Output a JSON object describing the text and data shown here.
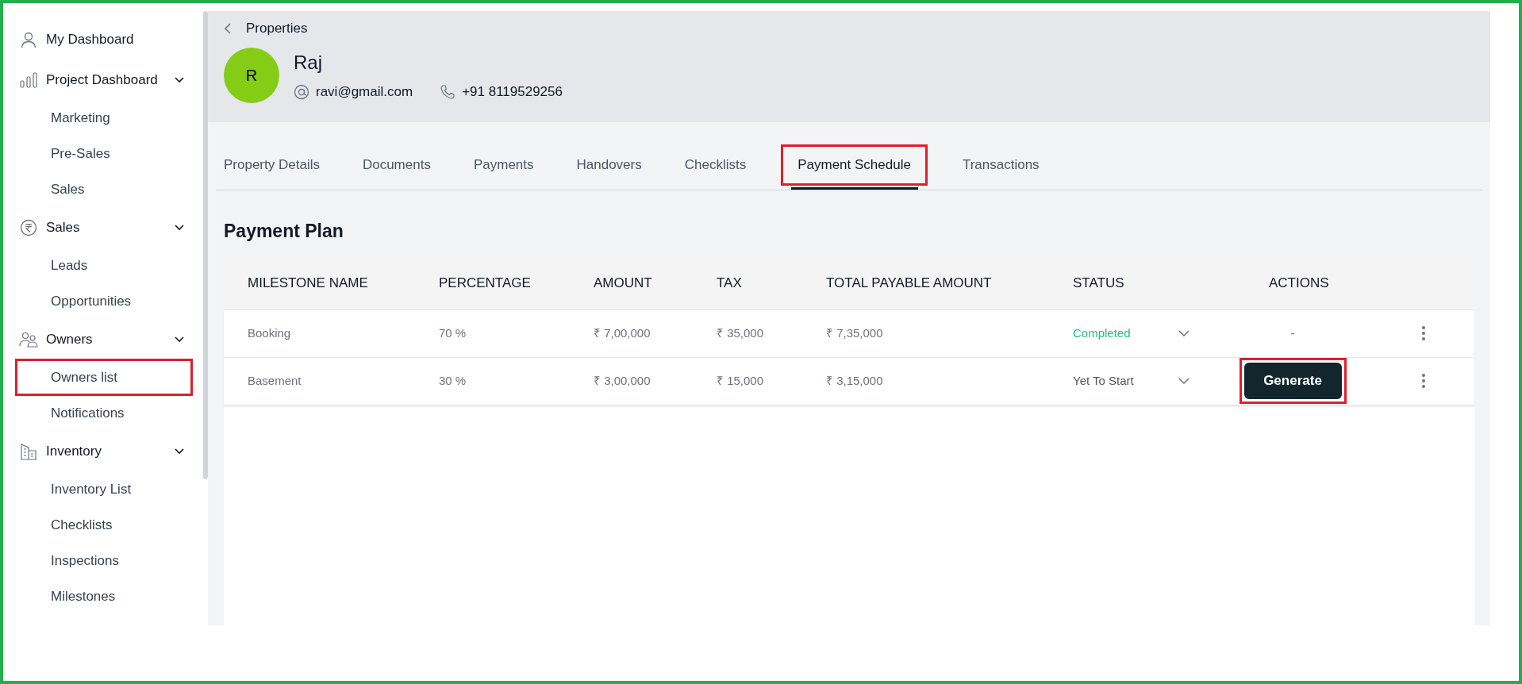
{
  "sidebar": {
    "items": [
      {
        "label": "My Dashboard",
        "highlighted": false
      },
      {
        "label": "Project Dashboard",
        "expanded": true,
        "children": [
          {
            "label": "Marketing",
            "highlighted": false
          },
          {
            "label": "Pre-Sales",
            "highlighted": false
          },
          {
            "label": "Sales",
            "highlighted": false
          }
        ]
      },
      {
        "label": "Sales",
        "expanded": true,
        "children": [
          {
            "label": "Leads",
            "highlighted": false
          },
          {
            "label": "Opportunities",
            "highlighted": false
          }
        ]
      },
      {
        "label": "Owners",
        "expanded": true,
        "children": [
          {
            "label": "Owners list",
            "highlighted": true
          },
          {
            "label": "Notifications",
            "highlighted": false
          }
        ]
      },
      {
        "label": "Inventory",
        "expanded": true,
        "children": [
          {
            "label": "Inventory List",
            "highlighted": false
          },
          {
            "label": "Checklists",
            "highlighted": false
          },
          {
            "label": "Inspections",
            "highlighted": false
          },
          {
            "label": "Milestones",
            "highlighted": false
          }
        ]
      }
    ]
  },
  "breadcrumb": "Properties",
  "owner": {
    "initial": "R",
    "name": "Raj",
    "email": "ravi@gmail.com",
    "phone": "+91 8119529256"
  },
  "tabs": [
    {
      "label": "Property Details",
      "selected": false,
      "highlighted": false
    },
    {
      "label": "Documents",
      "selected": false,
      "highlighted": false
    },
    {
      "label": "Payments",
      "selected": false,
      "highlighted": false
    },
    {
      "label": "Handovers",
      "selected": false,
      "highlighted": false
    },
    {
      "label": "Checklists",
      "selected": false,
      "highlighted": false
    },
    {
      "label": "Payment Schedule",
      "selected": true,
      "highlighted": true
    },
    {
      "label": "Transactions",
      "selected": false,
      "highlighted": false
    }
  ],
  "section_title": "Payment Plan",
  "table": {
    "columns": [
      "MILESTONE NAME",
      "PERCENTAGE",
      "AMOUNT",
      "TAX",
      "TOTAL PAYABLE AMOUNT",
      "STATUS",
      "ACTIONS"
    ],
    "rows": [
      {
        "cells": [
          "Booking",
          "70 %",
          "₹ 7,00,000",
          "₹ 35,000",
          "₹ 7,35,000"
        ],
        "status": "Completed",
        "color": "#22c07a",
        "action": {
          "kind": "text",
          "label": "-"
        }
      },
      {
        "cells": [
          "Basement",
          "30 %",
          "₹ 3,00,000",
          "₹ 15,000",
          "₹ 3,15,000"
        ],
        "status": "Yet To Start",
        "color": "#4b5563",
        "action": {
          "kind": "button",
          "label": "Generate",
          "highlighted": true
        }
      }
    ]
  }
}
